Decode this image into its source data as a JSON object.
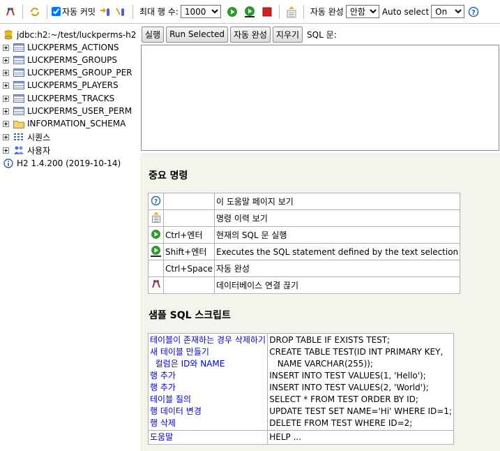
{
  "toolbar": {
    "autocommit_label": "자동 커밋",
    "autocommit_checked": true,
    "maxrows_label": "최대 행 수:",
    "maxrows_value": "1000",
    "autocomplete_label": "자동 완성",
    "autocomplete_value": "안함",
    "autoselect_label": "Auto select",
    "autoselect_value": "On"
  },
  "tree": {
    "connection": "jdbc:h2:~/test/luckperms-h2",
    "tables": [
      "LUCKPERMS_ACTIONS",
      "LUCKPERMS_GROUPS",
      "LUCKPERMS_GROUP_PER",
      "LUCKPERMS_PLAYERS",
      "LUCKPERMS_TRACKS",
      "LUCKPERMS_USER_PERM"
    ],
    "schema": "INFORMATION_SCHEMA",
    "sequences": "시퀀스",
    "users": "사용자",
    "version": "H2 1.4.200 (2019-10-14)"
  },
  "buttons": {
    "run": "실행",
    "run_selected": "Run Selected",
    "autocomplete": "자동 완성",
    "clear": "지우기",
    "sql_label": "SQL 문:"
  },
  "help": {
    "title": "중요 명령",
    "rows": [
      {
        "icon": "help-icon",
        "key": "",
        "desc": "이 도움말 페이지 보기"
      },
      {
        "icon": "history-icon",
        "key": "",
        "desc": "명령 이력 보기"
      },
      {
        "icon": "run-icon",
        "key": "Ctrl+엔터",
        "desc": "현재의 SQL 문 실행"
      },
      {
        "icon": "run-selected-icon",
        "key": "Shift+엔터",
        "desc": "Executes the SQL statement defined by the text selection"
      },
      {
        "icon": "",
        "key": "Ctrl+Space",
        "desc": "자동 완성"
      },
      {
        "icon": "disconnect-icon",
        "key": "",
        "desc": "데이터베이스 연결 끊기"
      }
    ]
  },
  "sample": {
    "title": "샘플 SQL 스크립트",
    "left": [
      "테이블이 존재하는 경우 삭제하기",
      "새 테이블 만들기",
      "  컬럼은 ID와 NAME",
      "행 추가",
      "행 추가",
      "테이블 질의",
      "행 데이터 변경",
      "행 삭제"
    ],
    "right": [
      "DROP TABLE IF EXISTS TEST;",
      "CREATE TABLE TEST(ID INT PRIMARY KEY,",
      "   NAME VARCHAR(255));",
      "INSERT INTO TEST VALUES(1, 'Hello');",
      "INSERT INTO TEST VALUES(2, 'World');",
      "SELECT * FROM TEST ORDER BY ID;",
      "UPDATE TEST SET NAME='Hi' WHERE ID=1;",
      "DELETE FROM TEST WHERE ID=2;"
    ],
    "help_left": "도움말",
    "help_right": "HELP ..."
  },
  "colors": {
    "link": "#0000cc",
    "help_bg": "#f5f4ec",
    "run_green": "#2e9a2e",
    "stop_red": "#d42020"
  }
}
